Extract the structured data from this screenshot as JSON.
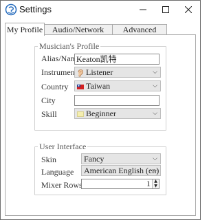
{
  "window": {
    "title": "Settings",
    "app_icon": "app-logo-icon",
    "controls": [
      "minimize-icon",
      "maximize-icon",
      "close-icon"
    ]
  },
  "tabs": [
    {
      "label": "My Profile",
      "active": true
    },
    {
      "label": "Audio/Network Setup",
      "active": false
    },
    {
      "label": "Advanced Setup",
      "active": false
    }
  ],
  "musicians_profile": {
    "legend": "Musician's Profile",
    "alias_label": "Alias/Name",
    "alias_value": "Keaton凯特",
    "instrument_label": "Instrument",
    "instrument_value": "Listener",
    "instrument_icon": "ear-icon",
    "country_label": "Country",
    "country_value": "Taiwan",
    "country_icon": "taiwan-flag-icon",
    "city_label": "City",
    "city_value": "",
    "skill_label": "Skill",
    "skill_value": "Beginner",
    "skill_swatch_color": "#f4eeb0"
  },
  "user_interface": {
    "legend": "User Interface",
    "skin_label": "Skin",
    "skin_value": "Fancy",
    "language_label": "Language",
    "language_value": "American English (en)",
    "mixer_rows_label": "Mixer Rows",
    "mixer_rows_value": "1"
  },
  "colors": {
    "combo_bg": "#e5e5e5",
    "border": "#a9a9a9",
    "accent": "#2a6fbf"
  }
}
